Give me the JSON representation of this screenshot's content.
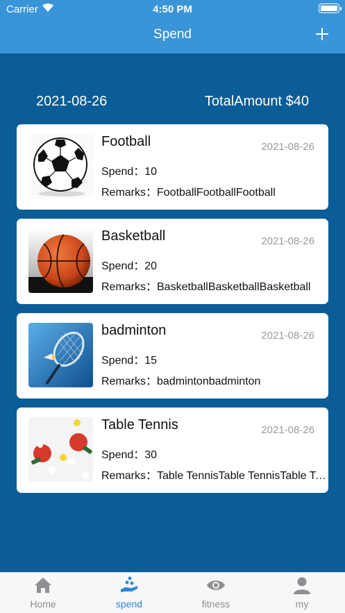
{
  "status_bar": {
    "carrier": "Carrier",
    "time": "4:50 PM"
  },
  "nav": {
    "title": "Spend",
    "add_icon": "plus-icon"
  },
  "summary": {
    "date": "2021-08-26",
    "total": "TotalAmount $40"
  },
  "records": [
    {
      "title": "Football",
      "date": "2021-08-26",
      "spend": "Spend：10",
      "remarks": "Remarks：FootballFootballFootball",
      "image": "soccer-ball"
    },
    {
      "title": "Basketball",
      "date": "2021-08-26",
      "spend": "Spend：20",
      "remarks": "Remarks：BasketballBasketballBasketball",
      "image": "basketball"
    },
    {
      "title": "badminton",
      "date": "2021-08-26",
      "spend": "Spend：15",
      "remarks": "Remarks：badmintonbadminton",
      "image": "badminton-racket"
    },
    {
      "title": "Table Tennis",
      "date": "2021-08-26",
      "spend": "Spend：30",
      "remarks": "Remarks：Table TennisTable TennisTable Tennis",
      "image": "table-tennis-paddles"
    }
  ],
  "tabs": [
    {
      "label": "Home",
      "icon": "home-icon",
      "active": false
    },
    {
      "label": "spend",
      "icon": "coins-hand-icon",
      "active": true
    },
    {
      "label": "fitness",
      "icon": "eye-icon",
      "active": false
    },
    {
      "label": "my",
      "icon": "person-icon",
      "active": false
    }
  ],
  "colors": {
    "nav_bar": "#3a94d8",
    "background": "#0a5d97",
    "tab_active": "#2e86de",
    "tab_inactive": "#8e8e93"
  }
}
